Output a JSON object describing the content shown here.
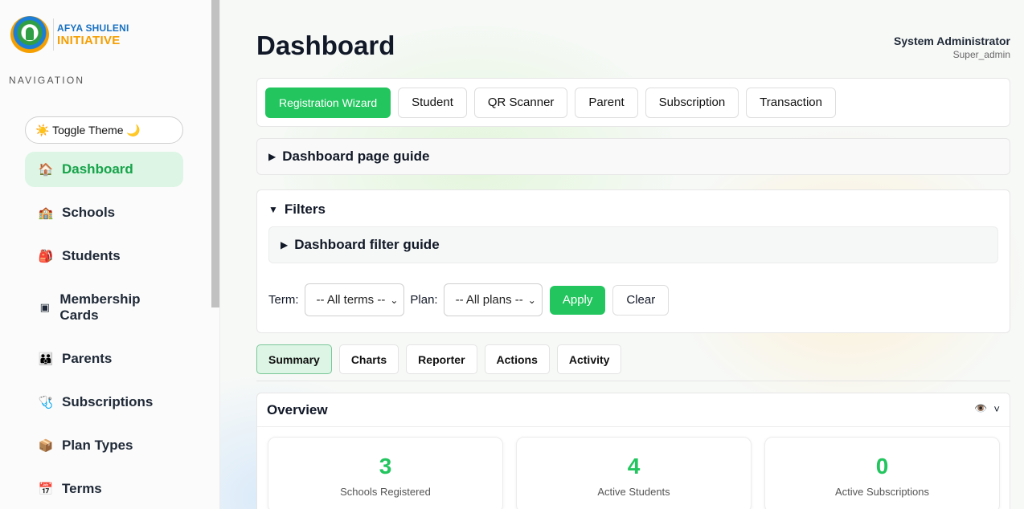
{
  "brand": {
    "line1": "AFYA SHULENI",
    "line2": "INITIATIVE"
  },
  "sidebar": {
    "heading": "NAVIGATION",
    "toggle_theme": "☀️ Toggle Theme 🌙",
    "items": [
      {
        "icon": "🏠",
        "label": "Dashboard"
      },
      {
        "icon": "🏫",
        "label": "Schools"
      },
      {
        "icon": "🎒",
        "label": "Students"
      },
      {
        "icon": "▣",
        "label": "Membership Cards"
      },
      {
        "icon": "👪",
        "label": "Parents"
      },
      {
        "icon": "🩺",
        "label": "Subscriptions"
      },
      {
        "icon": "📦",
        "label": "Plan Types"
      },
      {
        "icon": "📅",
        "label": "Terms"
      }
    ]
  },
  "header": {
    "title": "Dashboard",
    "user_name": "System Administrator",
    "user_role": "Super_admin"
  },
  "quick_actions": [
    "Registration Wizard",
    "Student",
    "QR Scanner",
    "Parent",
    "Subscription",
    "Transaction"
  ],
  "guide": {
    "toggle": "▶",
    "label": "Dashboard page guide"
  },
  "filters": {
    "toggle": "▼",
    "title": "Filters",
    "guide_toggle": "▶",
    "guide_label": "Dashboard filter guide",
    "term_label": "Term:",
    "term_value": "-- All terms --",
    "plan_label": "Plan:",
    "plan_value": "-- All plans --",
    "apply": "Apply",
    "clear": "Clear"
  },
  "tabs": [
    "Summary",
    "Charts",
    "Reporter",
    "Actions",
    "Activity"
  ],
  "overview": {
    "title": "Overview",
    "eye_icon": "👁️",
    "collapse_icon": "˅",
    "stats": [
      {
        "value": "3",
        "label": "Schools Registered"
      },
      {
        "value": "4",
        "label": "Active Students"
      },
      {
        "value": "0",
        "label": "Active Subscriptions"
      }
    ]
  }
}
